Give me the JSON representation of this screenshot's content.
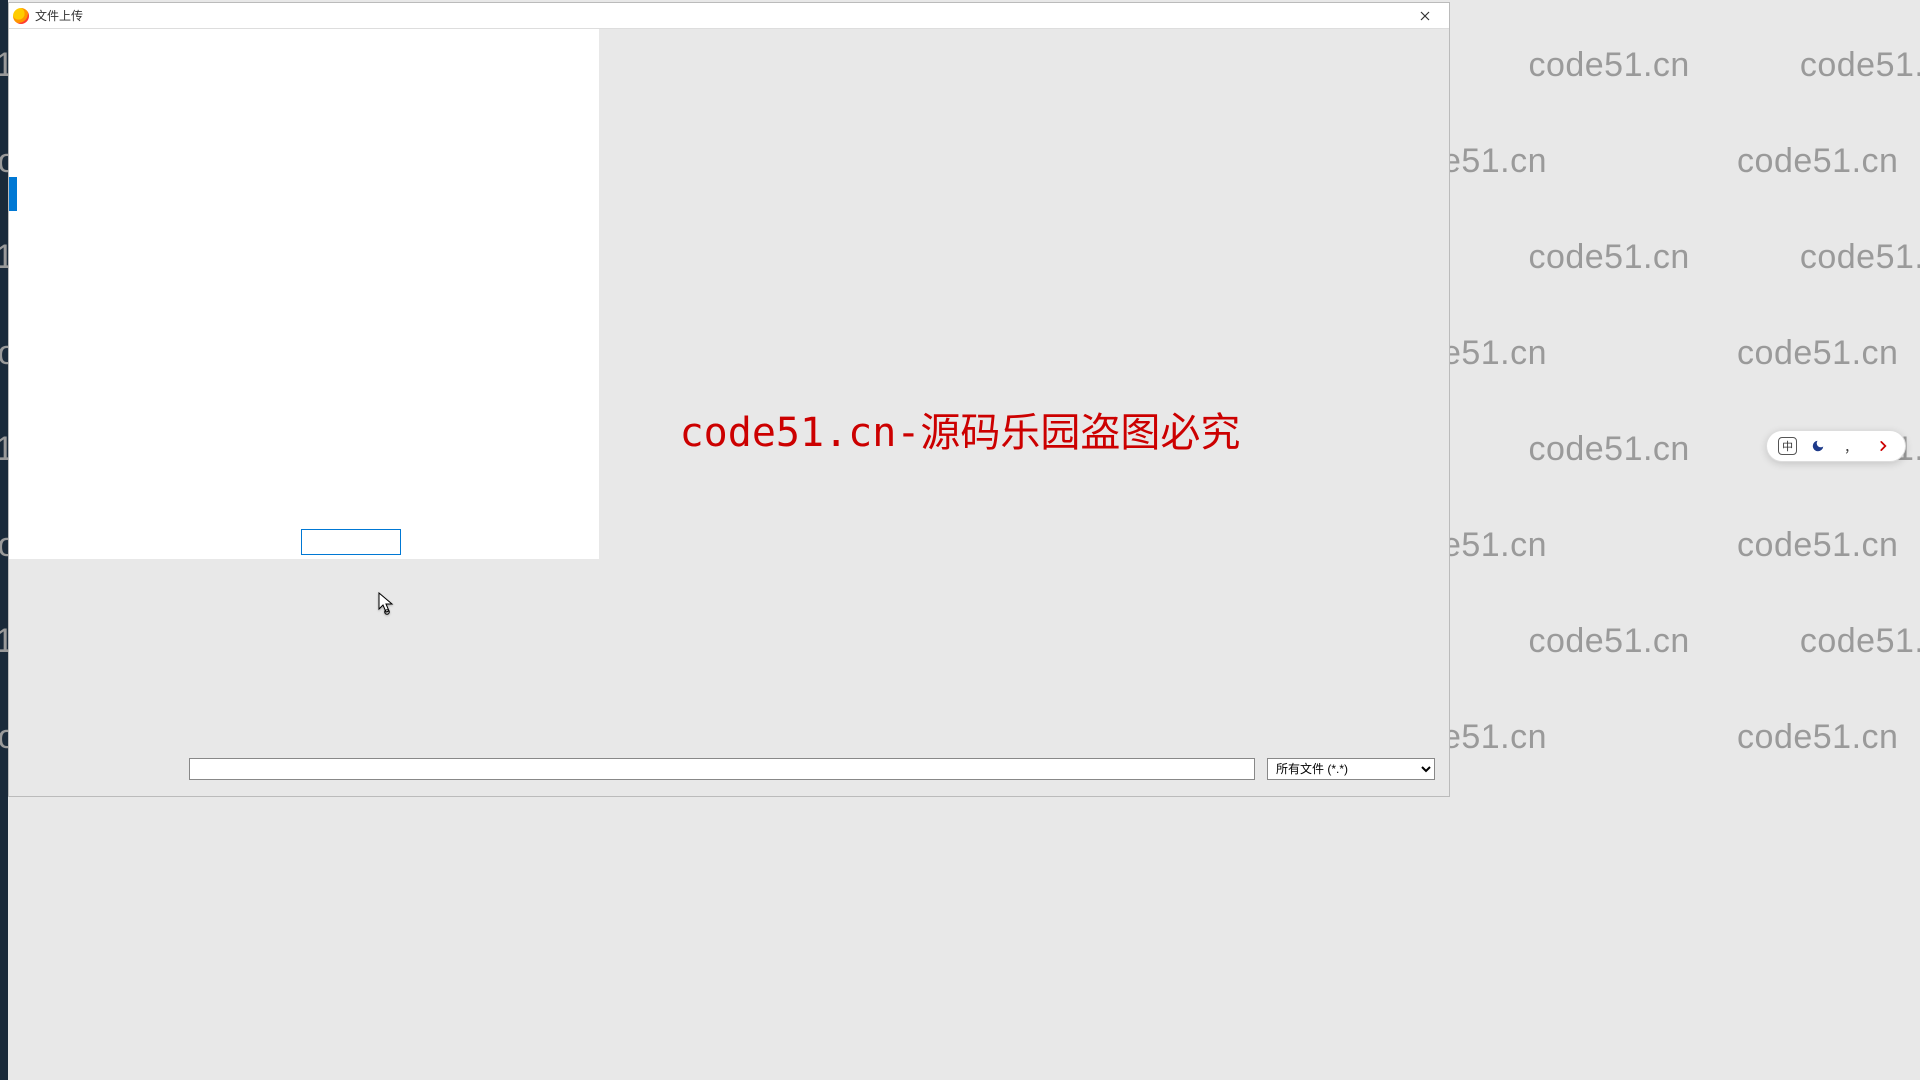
{
  "window": {
    "title": "文件上传"
  },
  "overlay_text": "code51.cn-源码乐园盗图必究",
  "watermark_text": "code51.cn",
  "rename_value": "",
  "filename_value": "",
  "filetype_selected": "所有文件 (*.*)",
  "ime": {
    "mode": "中",
    "punct": "，"
  }
}
